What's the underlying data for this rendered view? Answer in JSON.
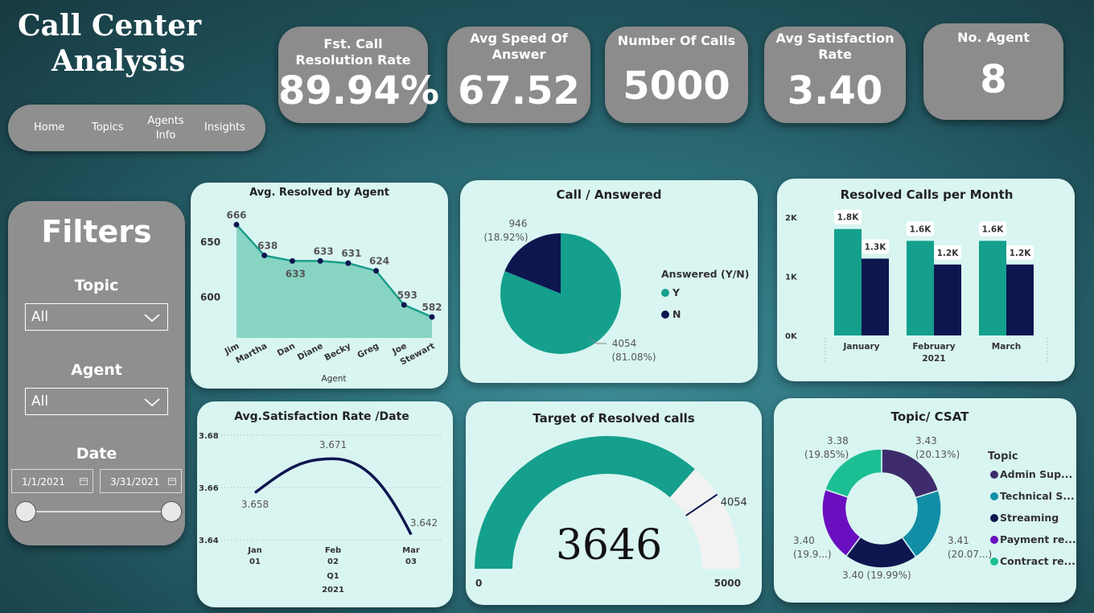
{
  "title": {
    "line1": "Call Center",
    "line2": "Analysis"
  },
  "kpis": [
    {
      "label": "Fst. Call Resolution Rate",
      "value": "89.94%"
    },
    {
      "label": "Avg Speed Of Answer",
      "value": "67.52"
    },
    {
      "label": "Number Of Calls",
      "value": "5000"
    },
    {
      "label": "Avg Satisfaction Rate",
      "value": "3.40"
    },
    {
      "label": "No. Agent",
      "value": "8"
    }
  ],
  "nav": {
    "home": "Home",
    "topics": "Topics",
    "agents1": "Agents",
    "agents2": "Info",
    "insights": "Insights"
  },
  "filters": {
    "title": "Filters",
    "topic_label": "Topic",
    "topic_value": "All",
    "agent_label": "Agent",
    "agent_value": "All",
    "date_label": "Date",
    "date_start": "1/1/2021",
    "date_end": "3/31/2021"
  },
  "chart_data": [
    {
      "id": "avg_resolved",
      "type": "area",
      "title": "Avg. Resolved by Agent",
      "xlabel": "Agent",
      "categories": [
        "Jim",
        "Martha",
        "Dan",
        "Diane",
        "Becky",
        "Greg",
        "Joe",
        "Stewart"
      ],
      "values": [
        666,
        638,
        633,
        633,
        631,
        624,
        593,
        582
      ],
      "yticks": [
        600,
        650
      ],
      "ylim": [
        563,
        675
      ],
      "color": "#1a9e8a"
    },
    {
      "id": "call_answered",
      "type": "pie",
      "title": "Call / Answered",
      "legend_title": "Answered (Y/N)",
      "slices": [
        {
          "name": "Y",
          "value": 4054,
          "pct": "(81.08%)",
          "color": "#14a08c"
        },
        {
          "name": "N",
          "value": 946,
          "pct": "(18.92%)",
          "color": "#0e1650"
        }
      ]
    },
    {
      "id": "resolved_month",
      "type": "bar",
      "title": "Resolved Calls per Month",
      "categories": [
        "January",
        "February",
        "March"
      ],
      "x_sublabel": "2021",
      "series": [
        {
          "values": [
            1800,
            1600,
            1600
          ],
          "labels": [
            "1.8K",
            "1.6K",
            "1.6K"
          ],
          "color": "#14a08c"
        },
        {
          "values": [
            1300,
            1200,
            1200
          ],
          "labels": [
            "1.3K",
            "1.2K",
            "1.2K"
          ],
          "color": "#0e1650"
        }
      ],
      "yticks": [
        "0K",
        "1K",
        "2K"
      ],
      "ylim": [
        0,
        2000
      ]
    },
    {
      "id": "sat_date",
      "type": "line",
      "title": "Avg.Satisfaction Rate /Date",
      "categories": [
        {
          "m": "Jan",
          "d": "01"
        },
        {
          "m": "Feb",
          "d": "02"
        },
        {
          "m": "Mar",
          "d": "03"
        }
      ],
      "quarter": "Q1",
      "year": "2021",
      "values": [
        3.658,
        3.671,
        3.642
      ],
      "labels": [
        "3.658",
        "3.671",
        "3.642"
      ],
      "yticks": [
        3.64,
        3.66,
        3.68
      ],
      "ytick_labels": [
        "3.64",
        "3.66",
        "3.68"
      ],
      "ylim": [
        3.64,
        3.68
      ],
      "color": "#0e1650"
    },
    {
      "id": "target",
      "type": "gauge",
      "title": "Target of Resolved calls",
      "value": 3646,
      "target": 4054,
      "min": 0,
      "max": 5000,
      "value_label": "3646",
      "target_label": "4054",
      "min_label": "0",
      "max_label": "5000"
    },
    {
      "id": "topic_csat",
      "type": "pie",
      "title": "Topic/ CSAT",
      "legend_title": "Topic",
      "slices": [
        {
          "name": "Admin Sup...",
          "value": 20.13,
          "label1": "3.43",
          "label2": "(20.13%)",
          "color": "#3d2b6b"
        },
        {
          "name": "Technical S...",
          "value": 20.07,
          "label1": "3.41",
          "label2": "(20.07...)",
          "color": "#118ea6"
        },
        {
          "name": "Streaming",
          "value": 19.99,
          "label1": "3.40 (19.99%)",
          "label2": "",
          "color": "#0e1650"
        },
        {
          "name": "Payment re...",
          "value": 19.96,
          "label1": "3.40",
          "label2": "(19.9...)",
          "color": "#6a0fbf"
        },
        {
          "name": "Contract re...",
          "value": 19.85,
          "label1": "3.38",
          "label2": "(19.85%)",
          "color": "#1bbf93"
        }
      ]
    }
  ]
}
